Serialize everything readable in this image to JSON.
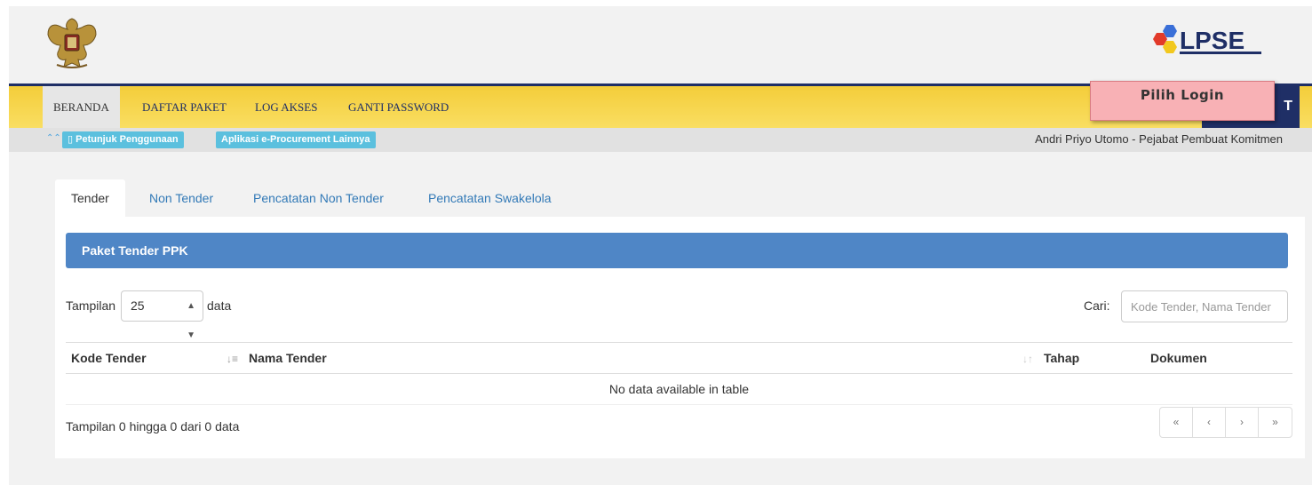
{
  "nav": {
    "items": [
      "BERANDA",
      "DAFTAR PAKET",
      "LOG AKSES",
      "GANTI PASSWORD"
    ],
    "right_button": "T"
  },
  "overlay": {
    "pilih_login": "Pilih Login"
  },
  "subbar": {
    "chevron": "≈",
    "pill_1": "Petunjuk Penggunaan",
    "pill_2": "Aplikasi e-Procurement Lainnya",
    "user": "Andri Priyo Utomo - Pejabat Pembuat Komitmen"
  },
  "logo": {
    "lpse_text": "LPSE"
  },
  "tabs": [
    "Tender",
    "Non Tender",
    "Pencatatan Non Tender",
    "Pencatatan Swakelola"
  ],
  "panel": {
    "title": "Paket Tender PPK",
    "length_label_before": "Tampilan",
    "length_value": "25",
    "length_label_after": "data",
    "search_label": "Cari:",
    "search_placeholder": "Kode Tender, Nama Tender",
    "columns": [
      "Kode Tender",
      "Nama Tender",
      "Tahap",
      "Dokumen"
    ],
    "empty_message": "No data available in table",
    "info": "Tampilan 0 hingga 0 dari 0 data",
    "pager": [
      "«",
      "‹",
      "›",
      "»"
    ]
  },
  "colors": {
    "nav_yellow": "#f4cd3a",
    "navy": "#1f2f66",
    "panel_blue": "#4f86c6",
    "pill_blue": "#5bc0de",
    "login_pink": "#f8b1b5"
  }
}
